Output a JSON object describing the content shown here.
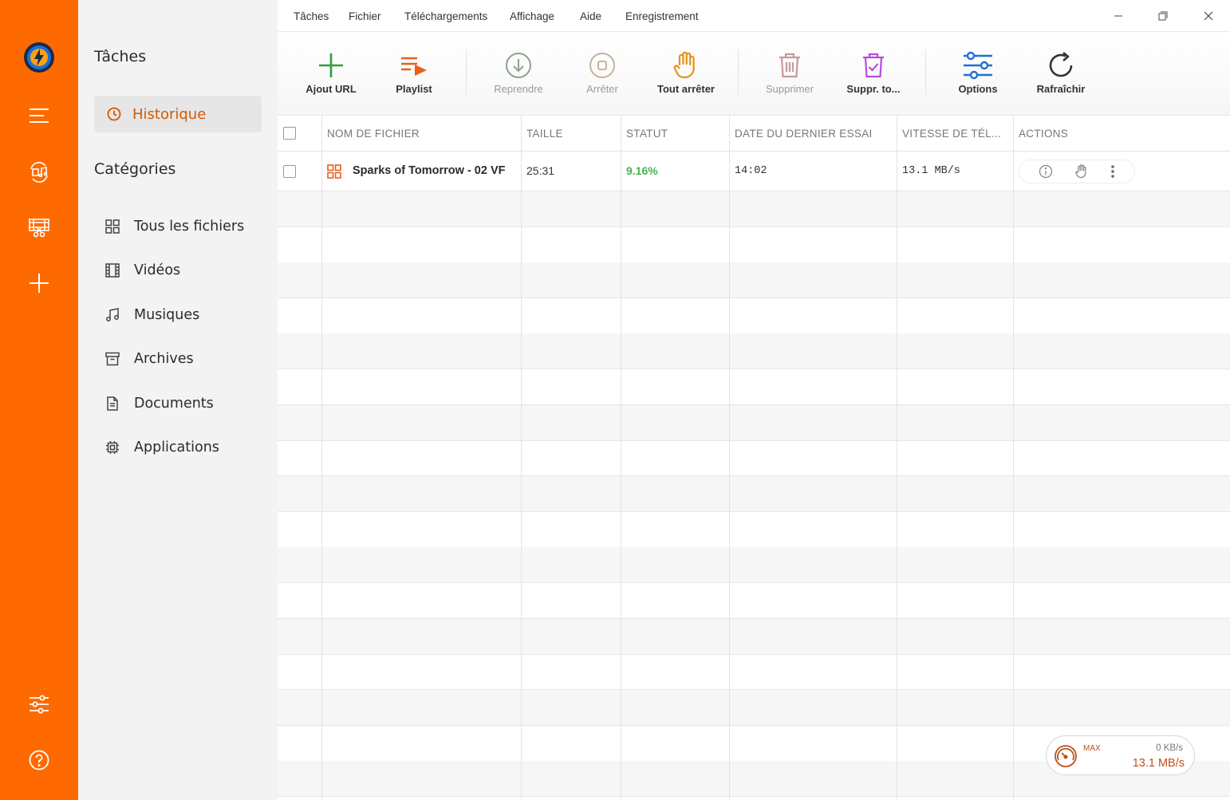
{
  "rail": {
    "icons": [
      "app-logo-icon",
      "hamburger-menu-icon",
      "music-convert-icon",
      "video-cut-icon",
      "plus-icon",
      "settings-sliders-icon",
      "help-icon"
    ],
    "accent": "#ff6a00"
  },
  "sidebar": {
    "tasks_title": "Tâches",
    "history_label": "Historique",
    "categories_title": "Catégories",
    "categories": [
      {
        "label": "Tous les fichiers",
        "icon": "grid-icon"
      },
      {
        "label": "Vidéos",
        "icon": "film-icon"
      },
      {
        "label": "Musiques",
        "icon": "music-note-icon"
      },
      {
        "label": "Archives",
        "icon": "archive-box-icon"
      },
      {
        "label": "Documents",
        "icon": "document-icon"
      },
      {
        "label": "Applications",
        "icon": "chip-icon"
      }
    ]
  },
  "menu": {
    "items": [
      "Tâches",
      "Fichier",
      "Téléchargements",
      "Affichage",
      "Aide",
      "Enregistrement"
    ]
  },
  "toolbar": {
    "add_url": "Ajout URL",
    "playlist": "Playlist",
    "resume": "Reprendre",
    "stop": "Arrêter",
    "stop_all": "Tout arrêter",
    "delete": "Supprimer",
    "delete_all": "Suppr. to...",
    "options": "Options",
    "refresh": "Rafraîchir"
  },
  "table": {
    "headers": [
      "NOM DE FICHIER",
      "TAILLE",
      "STATUT",
      "DATE DU DERNIER ESSAI",
      "VITESSE DE TÉL...",
      "ACTIONS"
    ],
    "rows": [
      {
        "name": "Sparks of Tomorrow - 02 VF",
        "size": "25:31",
        "status": "9.16%",
        "date": "14:02",
        "speed": "13.1 MB/s"
      }
    ],
    "status_color": "#4caf50"
  },
  "speed": {
    "max_label": "MAX",
    "upload": "0 KB/s",
    "download": "13.1 MB/s"
  }
}
